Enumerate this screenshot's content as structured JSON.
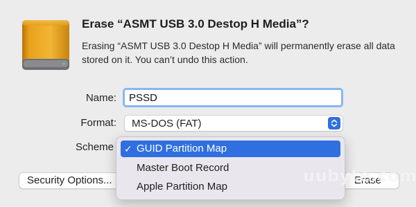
{
  "dialog": {
    "title": "Erase “ASMT USB 3.0 Destop H Media”?",
    "message": "Erasing “ASMT USB 3.0 Destop H Media” will permanently erase all data stored on it. You can’t undo this action."
  },
  "form": {
    "name_label": "Name:",
    "name_value": "PSSD",
    "format_label": "Format:",
    "format_value": "MS-DOS (FAT)",
    "scheme_label": "Scheme"
  },
  "scheme_menu": {
    "items": [
      {
        "label": "GUID Partition Map",
        "selected": true
      },
      {
        "label": "Master Boot Record",
        "selected": false
      },
      {
        "label": "Apple Partition Map",
        "selected": false
      }
    ],
    "check_glyph": "✓"
  },
  "buttons": {
    "security_options": "Security Options...",
    "erase": "Erase"
  },
  "watermark": "uubyte.com",
  "icons": {
    "drive": "external-drive-icon",
    "stepper": "chevron-up-down-icon"
  },
  "colors": {
    "accent": "#2f6fe0",
    "drive_body": "#e8a21c",
    "focus_ring": "#86b7f2"
  }
}
